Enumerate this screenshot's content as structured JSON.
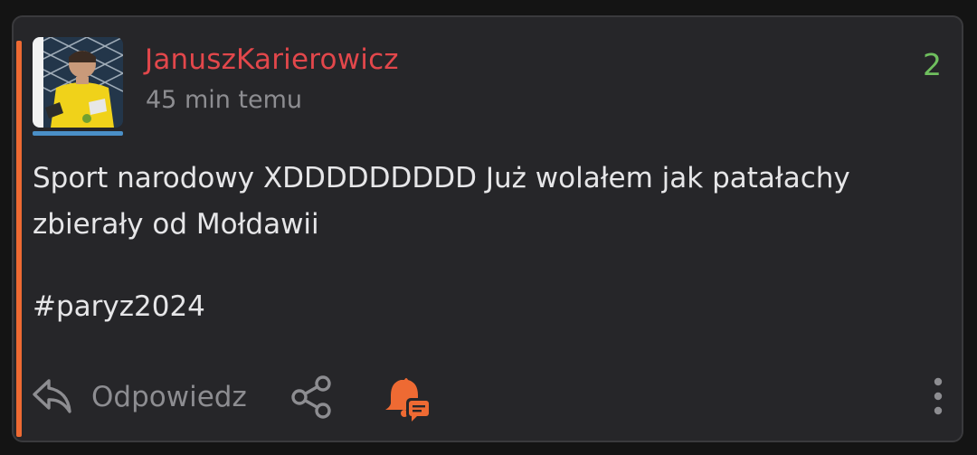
{
  "post": {
    "username": "JanuszKarierowicz",
    "timestamp": "45 min temu",
    "score": "2",
    "body": "Sport narodowy XDDDDDDDDD Już wolałem jak patałachy zbierały od Mołdawii",
    "tag": "#paryz2024"
  },
  "actions": {
    "reply_label": "Odpowiedz",
    "reply_icon": "reply-icon",
    "share_icon": "share-icon",
    "notify_icon": "bell-comment-icon",
    "more_icon": "more-vertical-icon"
  },
  "colors": {
    "accent": "#ee6a33",
    "username": "#e2474b",
    "score": "#6fbf5e",
    "avatar_underline": "#4a8fc7"
  }
}
